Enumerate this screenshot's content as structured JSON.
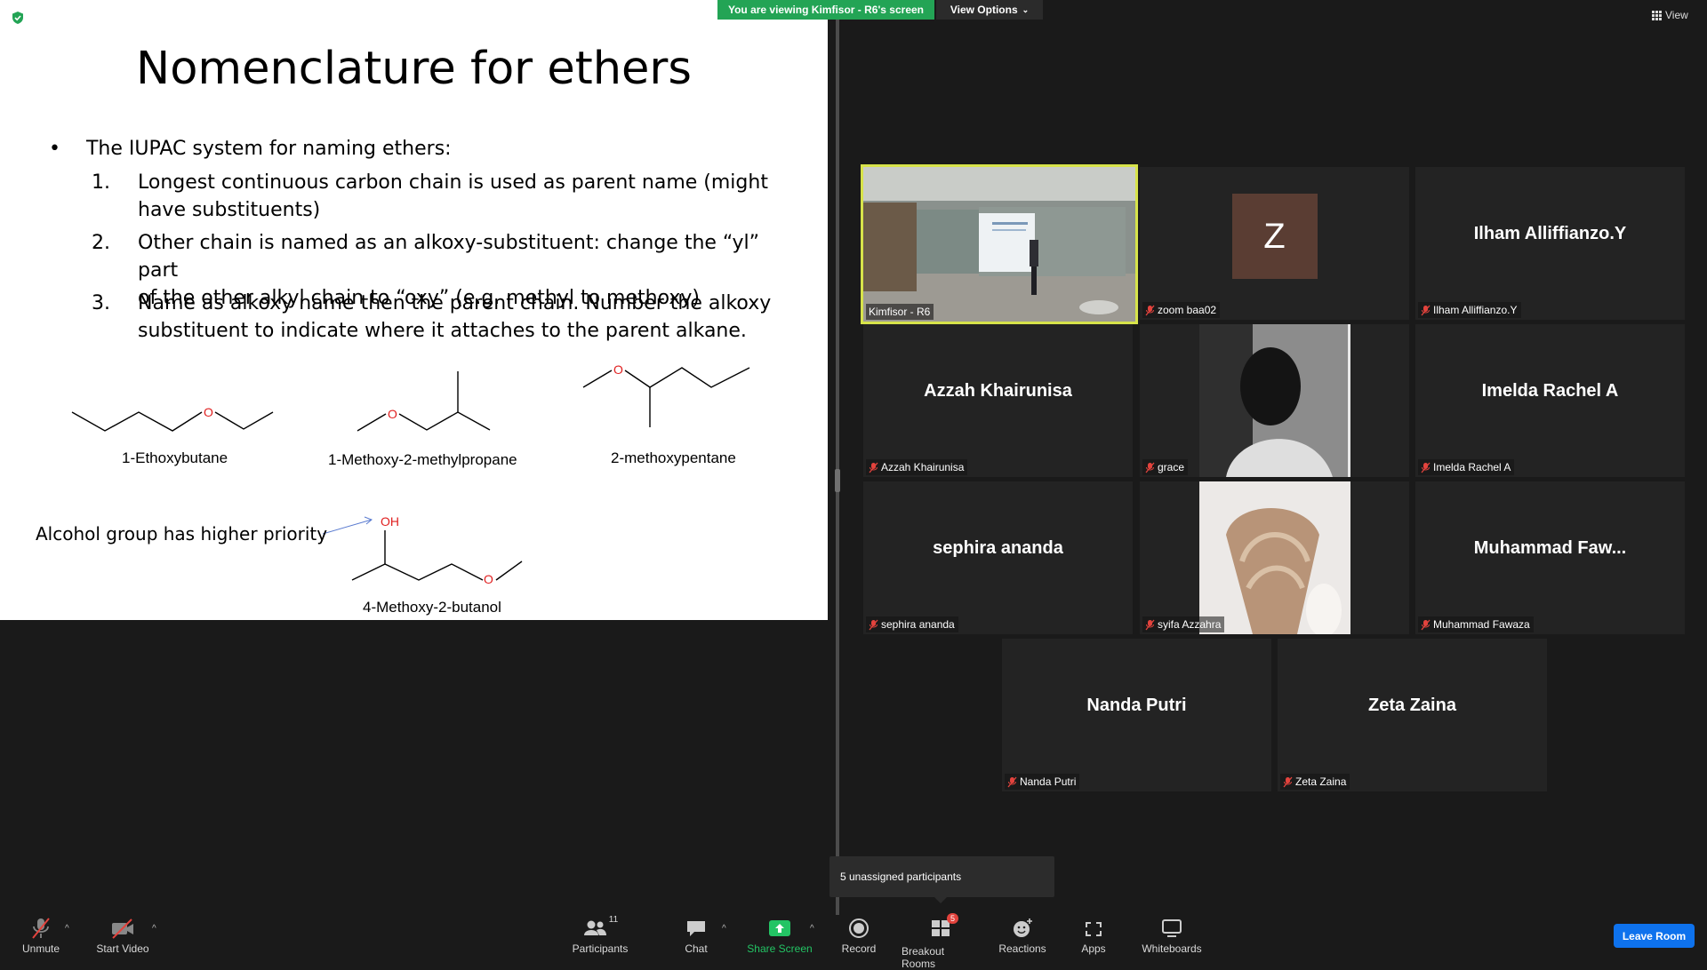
{
  "banner": {
    "text": "You are viewing Kimfisor - R6's screen",
    "color": "#23a455"
  },
  "view_options": {
    "label": "View Options"
  },
  "view_top": {
    "label": "View"
  },
  "slide": {
    "title": "Nomenclature for ethers",
    "bullet": "The IUPAC system for naming ethers:",
    "steps": [
      {
        "num": "1.",
        "line1": "Longest continuous carbon chain is used as parent name (might",
        "line2": "have substituents)"
      },
      {
        "num": "2.",
        "line1": "Other chain is named as an alkoxy-substituent: change the “yl” part",
        "line2": "of the other alkyl chain to “oxy” (e.g. methyl to methoxy)"
      },
      {
        "num": "3.",
        "line1": "Name as alkoxy name then the parent chain.  Number the alkoxy",
        "line2": "substituent to indicate where it attaches to the parent alkane."
      }
    ],
    "molecules": [
      "1-Ethoxybutane",
      "1-Methoxy-2-methylpropane",
      "2-methoxypentane",
      "4-Methoxy-2-butanol"
    ],
    "atom_o": "O",
    "atom_oh": "OH",
    "note": "Alcohol group has higher priority"
  },
  "tiles": [
    {
      "label": "Kimfisor - R6",
      "display": ""
    },
    {
      "label": "zoom baa02",
      "display": "Z"
    },
    {
      "label": "Ilham Alliffianzo.Y",
      "display": "Ilham Alliffianzo.Y"
    },
    {
      "label": "Azzah Khairunisa",
      "display": "Azzah Khairunisa"
    },
    {
      "label": "grace",
      "display": ""
    },
    {
      "label": "Imelda Rachel A",
      "display": "Imelda Rachel A"
    },
    {
      "label": "sephira ananda",
      "display": "sephira ananda"
    },
    {
      "label": "syifa Azzahra",
      "display": ""
    },
    {
      "label": "Muhammad Fawaza",
      "display": "Muhammad  Faw..."
    },
    {
      "label": "Nanda Putri",
      "display": "Nanda Putri"
    },
    {
      "label": "Zeta Zaina",
      "display": "Zeta Zaina"
    }
  ],
  "popup": {
    "text": "5 unassigned participants"
  },
  "toolbar": {
    "unmute": "Unmute",
    "start_video": "Start Video",
    "participants": "Participants",
    "participants_count": "11",
    "chat": "Chat",
    "share_screen": "Share Screen",
    "record": "Record",
    "breakout_rooms": "Breakout Rooms",
    "breakout_badge": "5",
    "reactions": "Reactions",
    "apps": "Apps",
    "whiteboards": "Whiteboards",
    "leave": "Leave Room"
  },
  "colors": {
    "accent_green": "#23a455",
    "leave_blue": "#0e72ed",
    "speaker_border": "#d7e34a",
    "oxygen_red": "#e02020"
  }
}
